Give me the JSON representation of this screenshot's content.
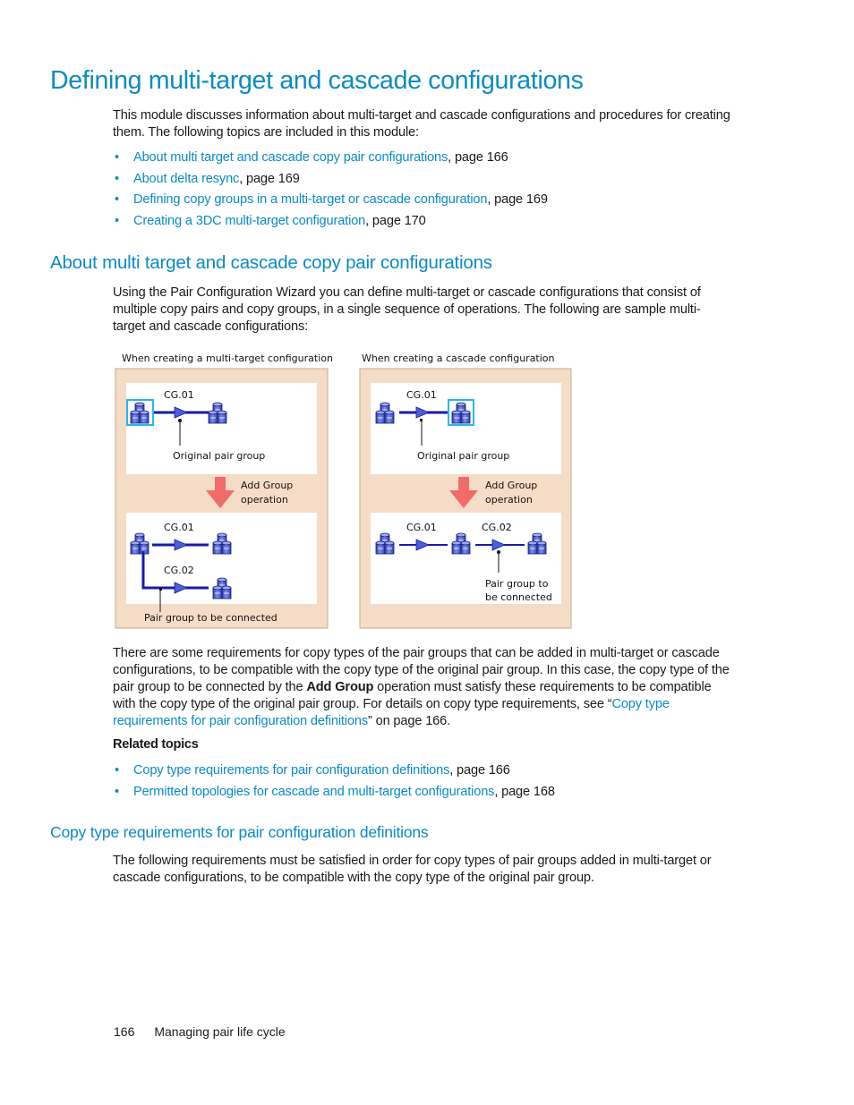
{
  "page": {
    "title": "Defining multi-target and cascade configurations",
    "intro": "This module discusses information about multi-target and cascade configurations and procedures for creating them. The following topics are included in this module:",
    "topics": [
      {
        "link": "About multi target and cascade copy pair configurations",
        "suffix": ", page 166"
      },
      {
        "link": "About delta resync",
        "suffix": ", page 169"
      },
      {
        "link": "Defining copy groups in a multi-target or cascade configuration",
        "suffix": ", page 169"
      },
      {
        "link": "Creating a 3DC multi-target configuration",
        "suffix": ", page 170"
      }
    ],
    "bullet": "•"
  },
  "section1": {
    "heading": "About multi target and cascade copy pair configurations",
    "para1": "Using the Pair Configuration Wizard you can define multi-target or cascade configurations that consist of multiple copy pairs and copy groups, in a single sequence of operations. The following are sample multi-target and cascade configurations:",
    "para2": {
      "before_bold": "There are some requirements for copy types of  the pair groups that can be added in multi-target or cascade configurations, to be compatible with the copy type of the original pair group. In this case, the copy type of the pair group to be connected by the ",
      "bold": "Add Group",
      "after_bold": " operation must satisfy these requirements to be compatible with the copy type of the original pair group. For details on copy type requirements, see “",
      "link": "Copy type requirements for pair configuration definitions",
      "end": "” on page 166."
    },
    "related_heading": "Related topics",
    "related": [
      {
        "link": "Copy type requirements for pair configuration definitions",
        "suffix": ", page 166"
      },
      {
        "link": "Permitted topologies for cascade and multi-target configurations",
        "suffix": ", page 168"
      }
    ]
  },
  "figure": {
    "multi_target": {
      "caption": "When creating a multi-target configuration",
      "before_group": "CG.01",
      "before_label": "Original pair group",
      "operation_line1": "Add Group",
      "operation_line2": "operation",
      "after_group1": "CG.01",
      "after_group2": "CG.02",
      "after_label": "Pair group to be connected"
    },
    "cascade": {
      "caption": "When creating a cascade configuration",
      "before_group": "CG.01",
      "before_label": "Original pair group",
      "operation_line1": "Add Group",
      "operation_line2": "operation",
      "after_group1": "CG.01",
      "after_group2": "CG.02",
      "after_label_line1": "Pair group to",
      "after_label_line2": "be connected"
    },
    "colors": {
      "panel_bg": "#f5dcc6",
      "panel_border": "#c9a98a",
      "arrow_red": "#f26b6b",
      "line_blue": "#1a1aa8",
      "selected_box": "#29b6f0",
      "disk_blue": "#4a5fd8"
    }
  },
  "section2": {
    "heading": "Copy type requirements for pair configuration definitions",
    "para": "The following requirements must be satisfied in order for copy types of pair groups added in multi-target or cascade configurations, to be compatible with the copy type of the original pair group."
  },
  "footer": {
    "page_number": "166",
    "chapter": "Managing pair life cycle"
  }
}
